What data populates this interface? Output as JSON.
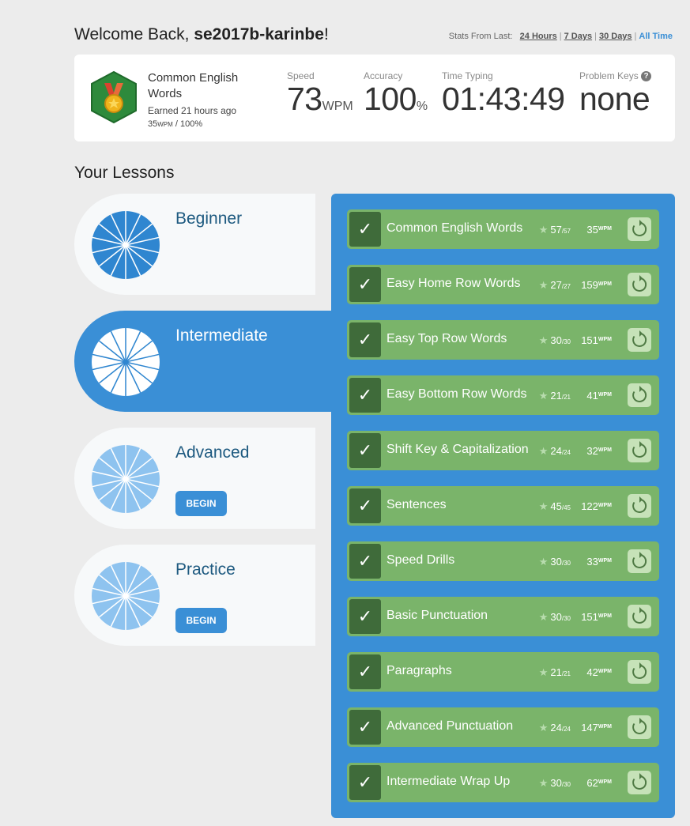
{
  "welcome": {
    "prefix": "Welcome Back, ",
    "username": "se2017b-karinbe",
    "suffix": "!"
  },
  "stats_from": {
    "label": "Stats From Last:",
    "options": [
      "24 Hours",
      "7 Days",
      "30 Days",
      "All Time"
    ],
    "selected": "All Time"
  },
  "badge": {
    "title": "Common English Words",
    "earned": "Earned 21 hours ago",
    "wpm": "35",
    "wpm_unit": "WPM",
    "accuracy": " / 100%",
    "icon": "medal-badge-icon",
    "colors": {
      "hex": "#2e8a3c",
      "medal": "#f0b41c",
      "ribbon": "#d9432f"
    }
  },
  "stats": {
    "speed": {
      "label": "Speed",
      "value": "73",
      "unit": "WPM"
    },
    "accuracy": {
      "label": "Accuracy",
      "value": "100",
      "unit": "%"
    },
    "time": {
      "label": "Time Typing",
      "value": "01:43:49"
    },
    "problem_keys": {
      "label": "Problem Keys",
      "value": "none",
      "help": "?"
    }
  },
  "your_lessons": "Your Lessons",
  "levels": [
    {
      "name": "Beginner",
      "active": false,
      "begin": null
    },
    {
      "name": "Intermediate",
      "active": true,
      "begin": null
    },
    {
      "name": "Advanced",
      "active": false,
      "begin": "BEGIN"
    },
    {
      "name": "Practice",
      "active": false,
      "begin": "BEGIN"
    }
  ],
  "lessons": [
    {
      "title": "Common English Words",
      "stars": "57",
      "total": "/57",
      "wpm": "35"
    },
    {
      "title": "Easy Home Row Words",
      "stars": "27",
      "total": "/27",
      "wpm": "159"
    },
    {
      "title": "Easy Top Row Words",
      "stars": "30",
      "total": "/30",
      "wpm": "151"
    },
    {
      "title": "Easy Bottom Row Words",
      "stars": "21",
      "total": "/21",
      "wpm": "41"
    },
    {
      "title": "Shift Key & Capitalization",
      "stars": "24",
      "total": "/24",
      "wpm": "32"
    },
    {
      "title": "Sentences",
      "stars": "45",
      "total": "/45",
      "wpm": "122"
    },
    {
      "title": "Speed Drills",
      "stars": "30",
      "total": "/30",
      "wpm": "33"
    },
    {
      "title": "Basic Punctuation",
      "stars": "30",
      "total": "/30",
      "wpm": "151"
    },
    {
      "title": "Paragraphs",
      "stars": "21",
      "total": "/21",
      "wpm": "42"
    },
    {
      "title": "Advanced Punctuation",
      "stars": "24",
      "total": "/24",
      "wpm": "147"
    },
    {
      "title": "Intermediate Wrap Up",
      "stars": "30",
      "total": "/30",
      "wpm": "62"
    }
  ],
  "wpm_unit": "WPM",
  "check_glyph": "✓",
  "star_glyph": "★",
  "colors": {
    "accent": "#3a8fd6",
    "lesson_green": "#7ab46a",
    "check_dark": "#3f6b3a",
    "pie_dark": "#2f86d0",
    "pie_light": "#8ec3ef"
  }
}
